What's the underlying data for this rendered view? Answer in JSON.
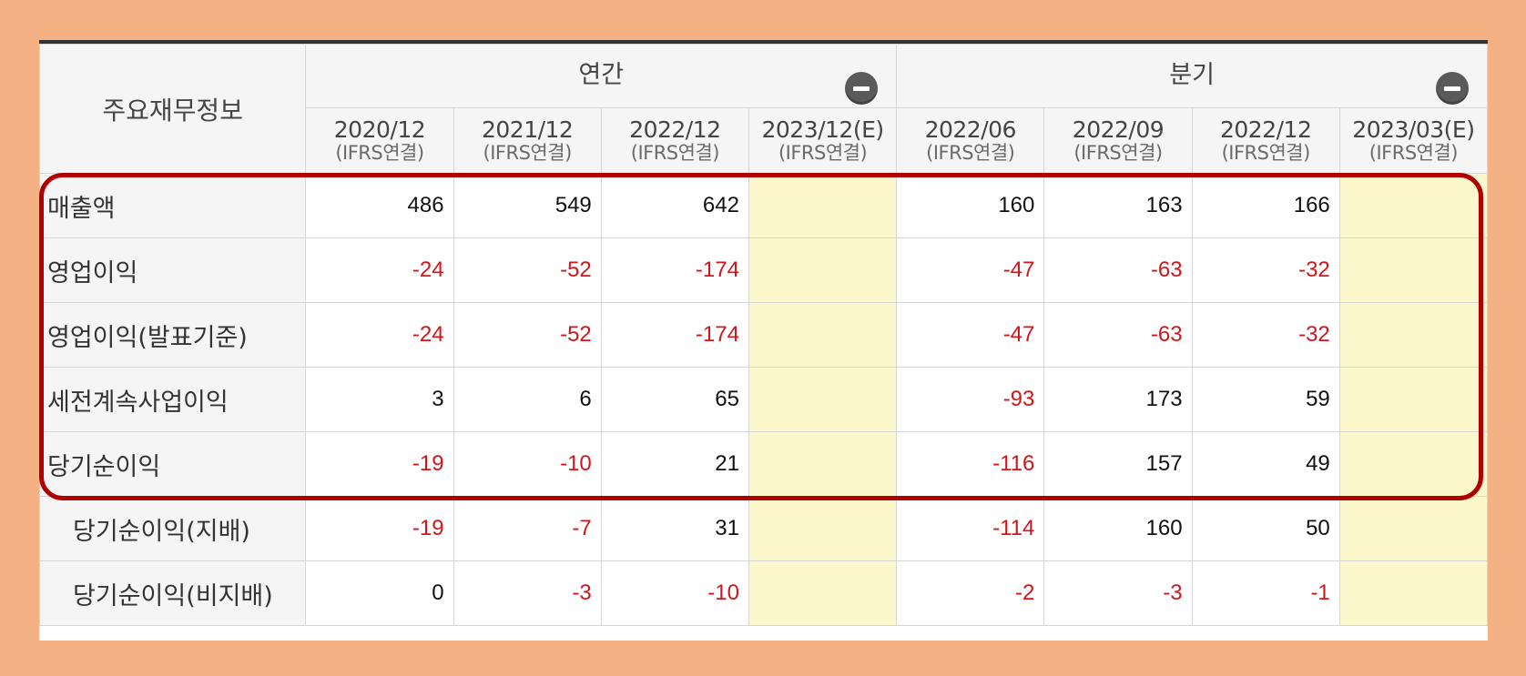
{
  "table": {
    "corner_label": "주요재무정보",
    "groups": [
      {
        "label": "연간"
      },
      {
        "label": "분기"
      }
    ],
    "periods": [
      {
        "date": "2020/12",
        "basis": "(IFRS연결)"
      },
      {
        "date": "2021/12",
        "basis": "(IFRS연결)"
      },
      {
        "date": "2022/12",
        "basis": "(IFRS연결)"
      },
      {
        "date": "2023/12(E)",
        "basis": "(IFRS연결)"
      },
      {
        "date": "2022/06",
        "basis": "(IFRS연결)"
      },
      {
        "date": "2022/09",
        "basis": "(IFRS연결)"
      },
      {
        "date": "2022/12",
        "basis": "(IFRS연결)"
      },
      {
        "date": "2023/03(E)",
        "basis": "(IFRS연결)"
      }
    ],
    "rows": [
      {
        "label": "매출액",
        "values": [
          "486",
          "549",
          "642",
          "",
          "160",
          "163",
          "166",
          ""
        ]
      },
      {
        "label": "영업이익",
        "values": [
          "-24",
          "-52",
          "-174",
          "",
          "-47",
          "-63",
          "-32",
          ""
        ]
      },
      {
        "label": "영업이익(발표기준)",
        "values": [
          "-24",
          "-52",
          "-174",
          "",
          "-47",
          "-63",
          "-32",
          ""
        ]
      },
      {
        "label": "세전계속사업이익",
        "values": [
          "3",
          "6",
          "65",
          "",
          "-93",
          "173",
          "59",
          ""
        ]
      },
      {
        "label": "당기순이익",
        "values": [
          "-19",
          "-10",
          "21",
          "",
          "-116",
          "157",
          "49",
          ""
        ]
      },
      {
        "label": "당기순이익(지배)",
        "values": [
          "-19",
          "-7",
          "31",
          "",
          "-114",
          "160",
          "50",
          ""
        ]
      },
      {
        "label": "당기순이익(비지배)",
        "values": [
          "0",
          "-3",
          "-10",
          "",
          "-2",
          "-3",
          "-1",
          ""
        ]
      }
    ]
  },
  "colors": {
    "negative": "#d0161b",
    "estimate_fill": "#fdf8cc",
    "highlight": "#b00000",
    "frame": "#f4b183"
  }
}
